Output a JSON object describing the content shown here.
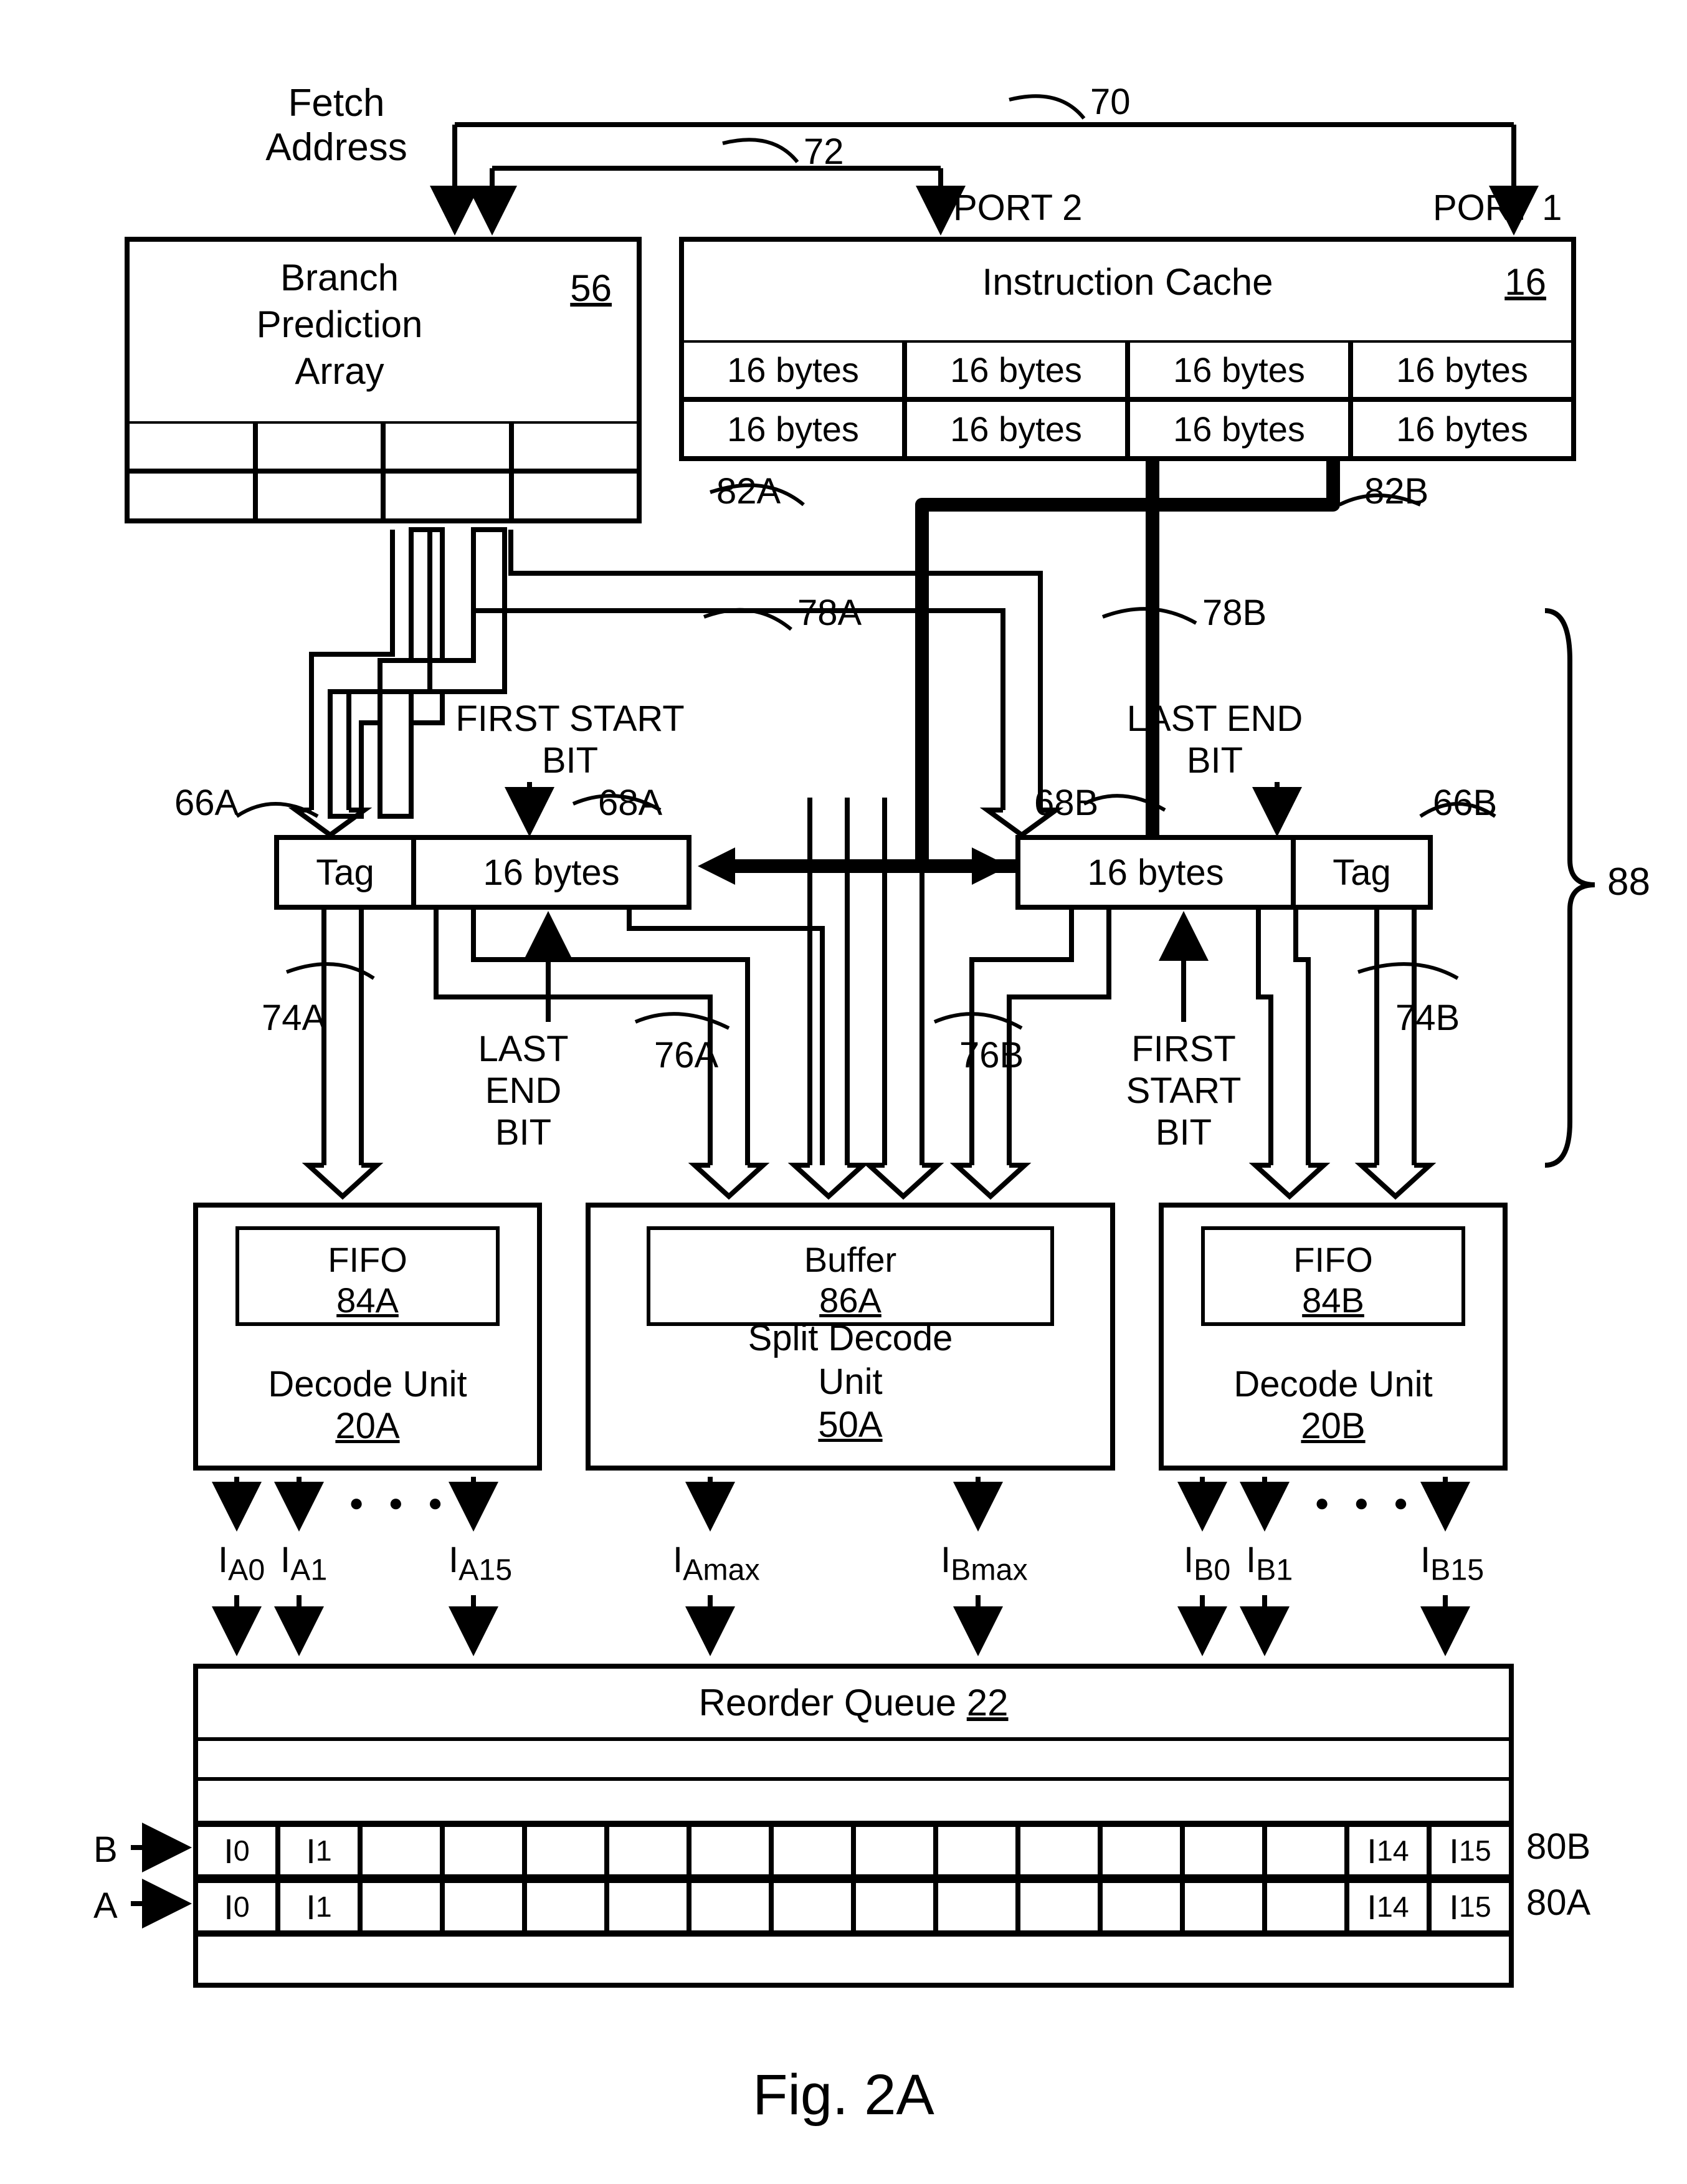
{
  "title": "Fetch Address",
  "ref70": "70",
  "ref72": "72",
  "port1": "PORT 1",
  "port2": "PORT 2",
  "bpa": {
    "title": "Branch\nPrediction\nArray",
    "ref": "56"
  },
  "icache": {
    "title": "Instruction Cache",
    "ref": "16",
    "cell": "16 bytes"
  },
  "ref82a": "82A",
  "ref82b": "82B",
  "ref78a": "78A",
  "ref78b": "78B",
  "firstStart": "FIRST START\nBIT",
  "lastEnd": "LAST END\nBIT",
  "tagA": {
    "label": "Tag",
    "ref": "66A"
  },
  "bytesA": {
    "label": "16 bytes",
    "ref": "68A"
  },
  "tagB": {
    "label": "Tag",
    "ref": "66B"
  },
  "bytesB": {
    "label": "16 bytes",
    "ref": "68B"
  },
  "ref74a": "74A",
  "ref76a": "76A",
  "ref74b": "74B",
  "ref76b": "76B",
  "ref88": "88",
  "lastEndV": "LAST\nEND\nBIT",
  "firstStartV": "FIRST\nSTART\nBIT",
  "decodeA": {
    "fifo": "FIFO",
    "fiforef": "84A",
    "title": "Decode Unit",
    "ref": "20A"
  },
  "split": {
    "buf": "Buffer",
    "bufref": "86A",
    "title": "Split Decode\nUnit",
    "ref": "50A"
  },
  "decodeB": {
    "fifo": "FIFO",
    "fiforef": "84B",
    "title": "Decode Unit",
    "ref": "20B"
  },
  "outA": [
    "I",
    "A0",
    "I",
    "A1",
    "I",
    "A15"
  ],
  "outSplit": [
    "I",
    "Amax",
    "I",
    "Bmax"
  ],
  "outB": [
    "I",
    "B0",
    "I",
    "B1",
    "I",
    "B15"
  ],
  "reorder": {
    "title": "Reorder Queue",
    "ref": "22"
  },
  "rowB": "B",
  "rowA": "A",
  "ref80b": "80B",
  "ref80a": "80A",
  "cells": [
    "I",
    "0",
    "I",
    "1",
    "I",
    "14",
    "I",
    "15"
  ],
  "fig": "Fig. 2A",
  "dots": "● ● ●"
}
